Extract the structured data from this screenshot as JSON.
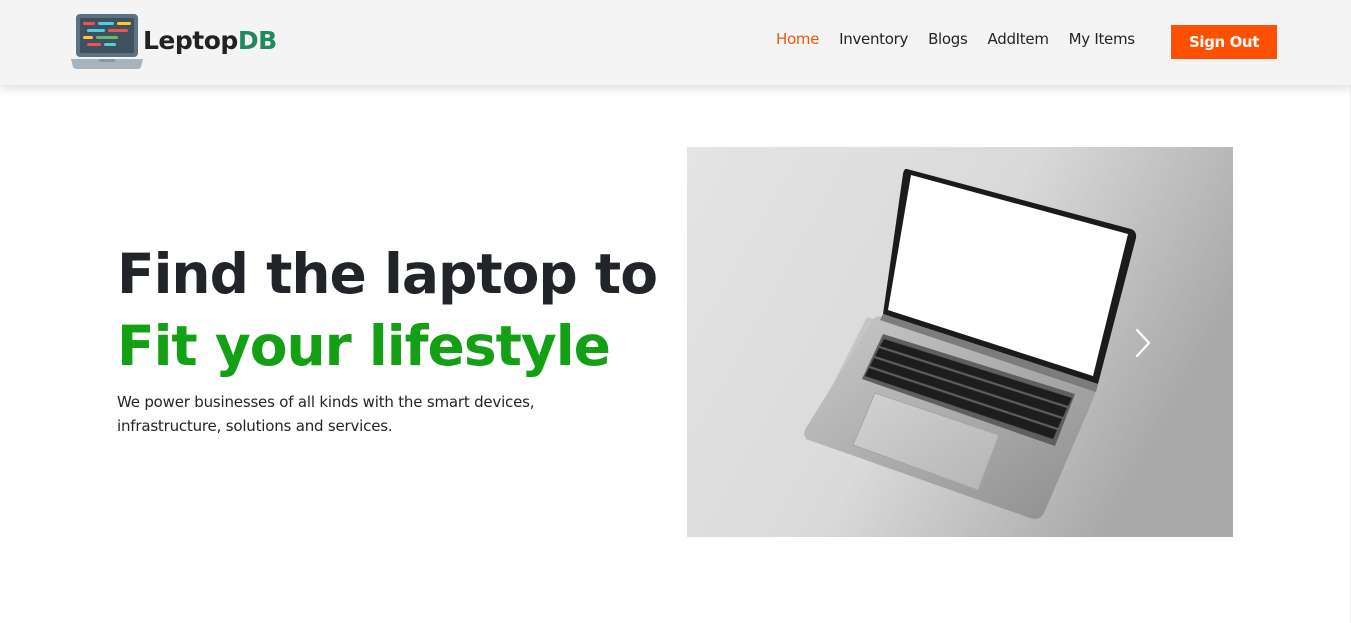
{
  "brand": {
    "name_prefix": "Leptop",
    "name_suffix": "DB",
    "logo_icon": "laptop-code-icon",
    "suffix_color": "#1f8a5c"
  },
  "nav": {
    "items": [
      {
        "label": "Home",
        "active": true
      },
      {
        "label": "Inventory",
        "active": false
      },
      {
        "label": "Blogs",
        "active": false
      },
      {
        "label": "AddItem",
        "active": false
      },
      {
        "label": "My Items",
        "active": false
      }
    ],
    "sign_out_label": "Sign Out",
    "active_color": "#ea5a0c",
    "button_color": "#fd5000"
  },
  "hero": {
    "headline_line1": "Find the laptop to",
    "headline_line2": "Fit your lifestyle",
    "description": "We power businesses of all kinds with the smart devices, infrastructure, solutions and services.",
    "accent_color": "#14a014"
  },
  "carousel": {
    "slide_image": "laptop-photo",
    "next_icon": "chevron-right-icon"
  }
}
